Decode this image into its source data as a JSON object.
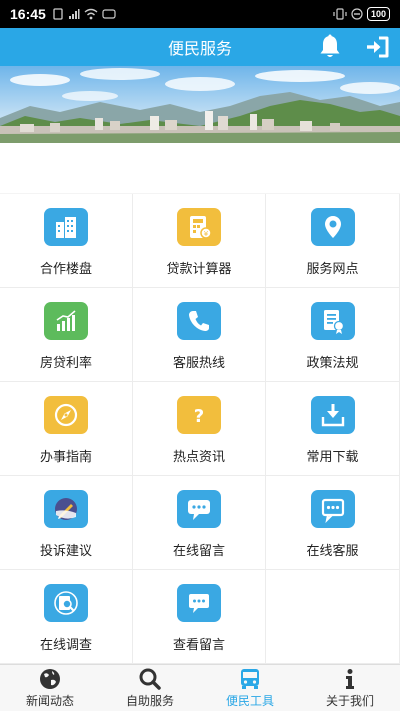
{
  "status_bar": {
    "time": "16:45",
    "left_glyphs": [
      "sim-icon",
      "signal-icon",
      "wifi-icon",
      "nfc-icon"
    ],
    "battery": "100"
  },
  "header": {
    "title": "便民服务",
    "right_icons": [
      "bell-icon",
      "logout-icon"
    ]
  },
  "banner": {
    "description_icon": "city-panorama-image"
  },
  "grid": [
    {
      "label": "合作楼盘",
      "icon": "building-icon",
      "color": "#3aa8e3"
    },
    {
      "label": "贷款计算器",
      "icon": "calculator-icon",
      "color": "#f2be3d"
    },
    {
      "label": "服务网点",
      "icon": "location-pin-icon",
      "color": "#3aa8e3"
    },
    {
      "label": "房贷利率",
      "icon": "bar-chart-icon",
      "color": "#5dbb5c"
    },
    {
      "label": "客服热线",
      "icon": "phone-icon",
      "color": "#3aa8e3"
    },
    {
      "label": "政策法规",
      "icon": "document-badge-icon",
      "color": "#3aa8e3"
    },
    {
      "label": "办事指南",
      "icon": "compass-icon",
      "color": "#f2be3d"
    },
    {
      "label": "热点资讯",
      "icon": "question-icon",
      "color": "#f2be3d"
    },
    {
      "label": "常用下载",
      "icon": "download-icon",
      "color": "#3aa8e3"
    },
    {
      "label": "投诉建议",
      "icon": "pen-feedback-icon",
      "color": "#3aa8e3"
    },
    {
      "label": "在线留言",
      "icon": "chat-bubble-icon",
      "color": "#3aa8e3"
    },
    {
      "label": "在线客服",
      "icon": "chat-square-icon",
      "color": "#3aa8e3"
    },
    {
      "label": "在线调查",
      "icon": "survey-search-icon",
      "color": "#3aa8e3"
    },
    {
      "label": "查看留言",
      "icon": "message-view-icon",
      "color": "#3aa8e3"
    }
  ],
  "bottom_nav": [
    {
      "label": "新闻动态",
      "icon": "globe-icon",
      "active": false
    },
    {
      "label": "自助服务",
      "icon": "magnifier-icon",
      "active": false
    },
    {
      "label": "便民工具",
      "icon": "bus-icon",
      "active": true
    },
    {
      "label": "关于我们",
      "icon": "info-icon",
      "active": false
    }
  ],
  "colors": {
    "header_bg": "#2aa7e6",
    "accent_blue": "#3aa8e3",
    "accent_yellow": "#f2be3d",
    "accent_green": "#5dbb5c",
    "nav_active": "#2aa7e6",
    "nav_inactive": "#333333"
  }
}
